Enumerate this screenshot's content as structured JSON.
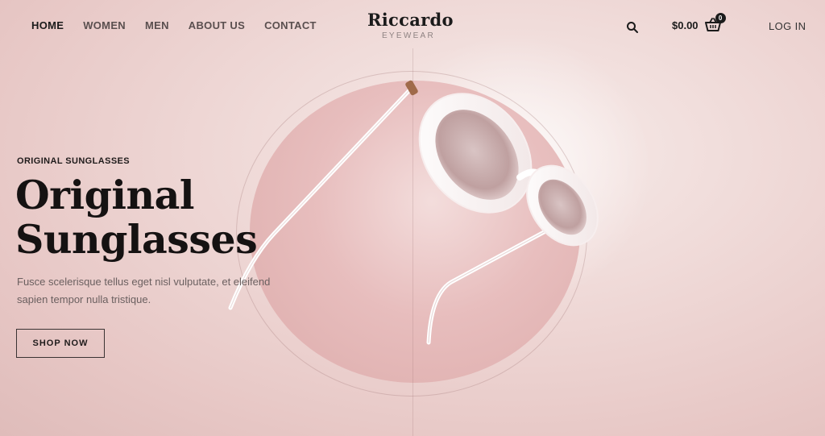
{
  "nav": {
    "items": [
      "HOME",
      "WOMEN",
      "MEN",
      "ABOUT US",
      "CONTACT"
    ],
    "active": "HOME"
  },
  "logo": {
    "name": "Riccardo",
    "tagline": "EYEWEAR"
  },
  "header": {
    "search_icon": "search-icon",
    "cart_total": "$0.00",
    "cart_count": "0",
    "cart_icon": "basket-icon",
    "login_label": "LOG IN"
  },
  "hero": {
    "eyebrow": "ORIGINAL SUNGLASSES",
    "headline_line1": "Original",
    "headline_line2": "Sunglasses",
    "description": "Fusce scelerisque tellus eget nisl vulputate, et eleifend sapien tempor nulla tristique.",
    "cta_label": "SHOP NOW"
  },
  "colors": {
    "background": "#efd9d7",
    "accent_dark": "#1b1b1b",
    "blob": "#e7bcbc"
  }
}
